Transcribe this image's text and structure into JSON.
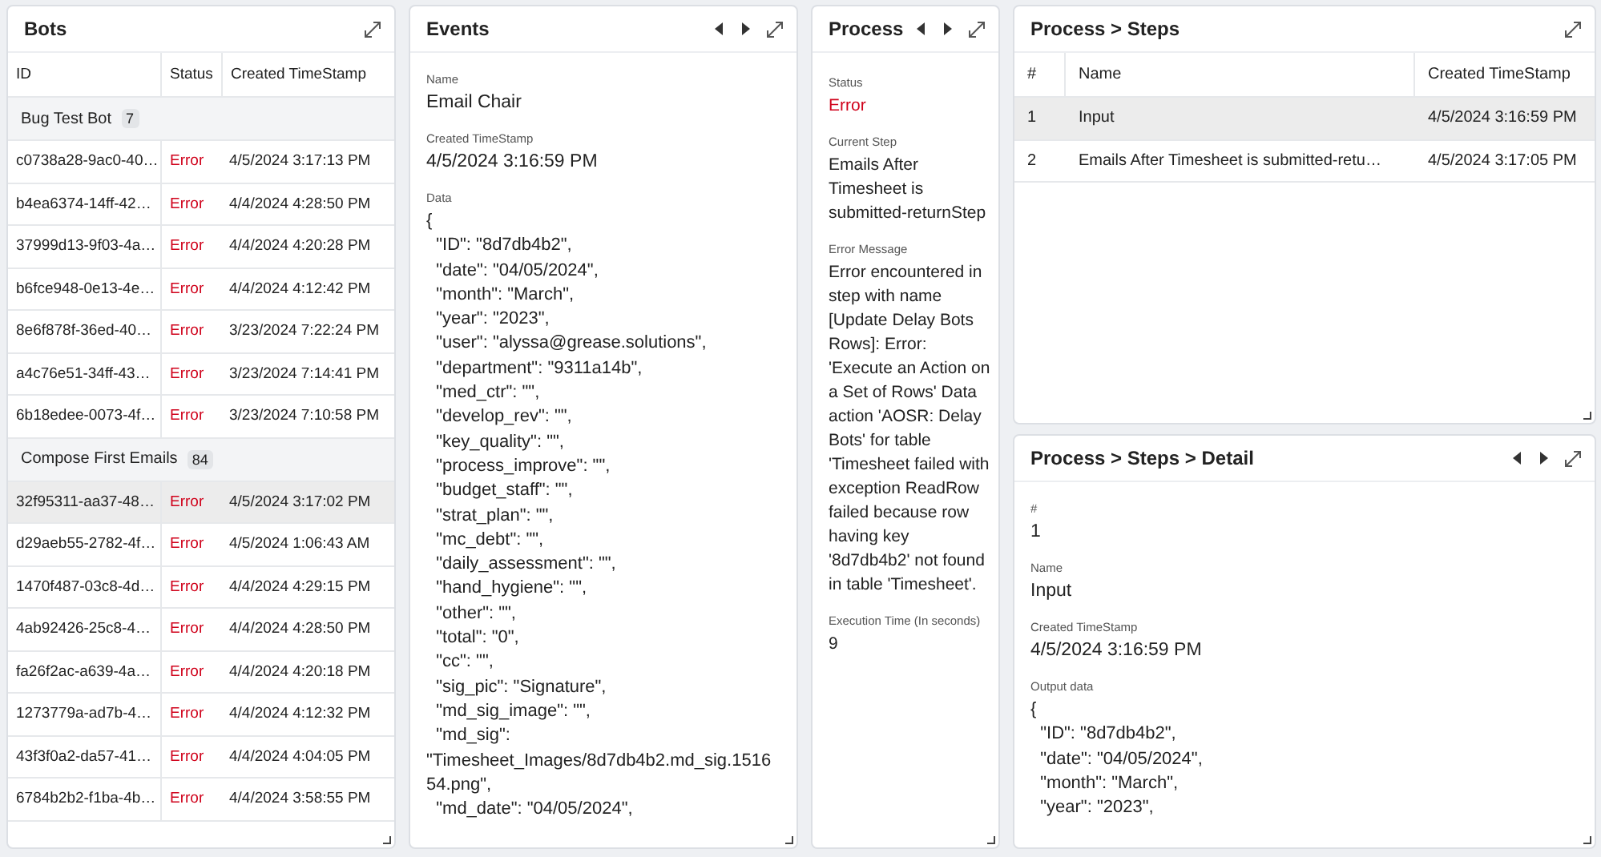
{
  "bots": {
    "title": "Bots",
    "columns": [
      "ID",
      "Status",
      "Created TimeStamp"
    ],
    "groups": [
      {
        "label": "Bug Test Bot",
        "count": "7",
        "rows": [
          {
            "id": "c0738a28-9ac0-40…",
            "status": "Error",
            "created": "4/5/2024 3:17:13 PM",
            "selected": false
          },
          {
            "id": "b4ea6374-14ff-42…",
            "status": "Error",
            "created": "4/4/2024 4:28:50 PM",
            "selected": false
          },
          {
            "id": "37999d13-9f03-4a…",
            "status": "Error",
            "created": "4/4/2024 4:20:28 PM",
            "selected": false
          },
          {
            "id": "b6fce948-0e13-4e…",
            "status": "Error",
            "created": "4/4/2024 4:12:42 PM",
            "selected": false
          },
          {
            "id": "8e6f878f-36ed-40…",
            "status": "Error",
            "created": "3/23/2024 7:22:24 PM",
            "selected": false
          },
          {
            "id": "a4c76e51-34ff-43…",
            "status": "Error",
            "created": "3/23/2024 7:14:41 PM",
            "selected": false
          },
          {
            "id": "6b18edee-0073-4f…",
            "status": "Error",
            "created": "3/23/2024 7:10:58 PM",
            "selected": false
          }
        ]
      },
      {
        "label": "Compose First Emails",
        "count": "84",
        "rows": [
          {
            "id": "32f95311-aa37-48…",
            "status": "Error",
            "created": "4/5/2024 3:17:02 PM",
            "selected": true
          },
          {
            "id": "d29aeb55-2782-4f…",
            "status": "Error",
            "created": "4/5/2024 1:06:43 AM",
            "selected": false
          },
          {
            "id": "1470f487-03c8-4d…",
            "status": "Error",
            "created": "4/4/2024 4:29:15 PM",
            "selected": false
          },
          {
            "id": "4ab92426-25c8-4…",
            "status": "Error",
            "created": "4/4/2024 4:28:50 PM",
            "selected": false
          },
          {
            "id": "fa26f2ac-a639-4a…",
            "status": "Error",
            "created": "4/4/2024 4:20:18 PM",
            "selected": false
          },
          {
            "id": "1273779a-ad7b-4…",
            "status": "Error",
            "created": "4/4/2024 4:12:32 PM",
            "selected": false
          },
          {
            "id": "43f3f0a2-da57-41…",
            "status": "Error",
            "created": "4/4/2024 4:04:05 PM",
            "selected": false
          },
          {
            "id": "6784b2b2-f1ba-4b…",
            "status": "Error",
            "created": "4/4/2024 3:58:55 PM",
            "selected": false
          }
        ]
      }
    ]
  },
  "events": {
    "title": "Events",
    "nav": true,
    "fields": [
      {
        "kind": "text",
        "label": "Name",
        "value": "Email Chair"
      },
      {
        "kind": "text",
        "label": "Created TimeStamp",
        "value": "4/5/2024 3:16:59 PM"
      },
      {
        "kind": "code",
        "label": "Data",
        "lines": [
          "{",
          "  \"ID\": \"8d7db4b2\",",
          "  \"date\": \"04/05/2024\",",
          "  \"month\": \"March\",",
          "  \"year\": \"2023\",",
          "  \"user\": \"alyssa@grease.solutions\",",
          "  \"department\": \"9311a14b\",",
          "  \"med_ctr\": \"\",",
          "  \"develop_rev\": \"\",",
          "  \"key_quality\": \"\",",
          "  \"process_improve\": \"\",",
          "  \"budget_staff\": \"\",",
          "  \"strat_plan\": \"\",",
          "  \"mc_debt\": \"\",",
          "  \"daily_assessment\": \"\",",
          "  \"hand_hygiene\": \"\",",
          "  \"other\": \"\",",
          "  \"total\": \"0\",",
          "  \"cc\": \"\",",
          "  \"sig_pic\": \"Signature\",",
          "  \"md_sig_image\": \"\",",
          "  \"md_sig\": \"Timesheet_Images/8d7db4b2.md_sig.151654.png\",",
          "  \"md_date\": \"04/05/2024\","
        ]
      }
    ]
  },
  "process": {
    "title": "Process",
    "nav": true,
    "fields": [
      {
        "kind": "status",
        "label": "Status",
        "value": "Error"
      },
      {
        "kind": "text",
        "label": "Current Step",
        "value": "Emails After Timesheet is submitted-returnStep"
      },
      {
        "kind": "text",
        "label": "Error Message",
        "value": "Error encountered in step with name [Update Delay Bots Rows]: Error: 'Execute an Action on a Set of Rows' Data action 'AOSR: Delay Bots' for table 'Timesheet failed with exception ReadRow failed because row having key '8d7db4b2' not found in table 'Timesheet'."
      },
      {
        "kind": "text",
        "label": "Execution Time (In seconds)",
        "value": "9"
      }
    ]
  },
  "steps": {
    "title": "Process > Steps",
    "columns": [
      "#",
      "Name",
      "Created TimeStamp"
    ],
    "rows": [
      {
        "num": "1",
        "name": "Input",
        "created": "4/5/2024 3:16:59 PM",
        "selected": true
      },
      {
        "num": "2",
        "name": "Emails After Timesheet is submitted-retu…",
        "created": "4/5/2024 3:17:05 PM",
        "selected": false
      }
    ]
  },
  "step_detail": {
    "title": "Process > Steps > Detail",
    "nav": true,
    "fields": [
      {
        "kind": "text",
        "label": "#",
        "value": "1"
      },
      {
        "kind": "text",
        "label": "Name",
        "value": "Input"
      },
      {
        "kind": "text",
        "label": "Created TimeStamp",
        "value": "4/5/2024 3:16:59 PM"
      },
      {
        "kind": "code",
        "label": "Output data",
        "lines": [
          "{",
          "  \"ID\": \"8d7db4b2\",",
          "  \"date\": \"04/05/2024\",",
          "  \"month\": \"March\",",
          "  \"year\": \"2023\","
        ]
      }
    ]
  }
}
